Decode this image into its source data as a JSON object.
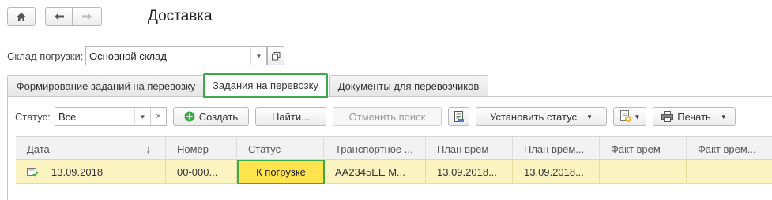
{
  "header": {
    "title": "Доставка"
  },
  "warehouse": {
    "label": "Склад погрузки:",
    "value": "Основной склад"
  },
  "tabs": [
    {
      "label": "Формирование заданий на перевозку",
      "active": false
    },
    {
      "label": "Задания на перевозку",
      "active": true
    },
    {
      "label": "Документы для перевозчиков",
      "active": false
    }
  ],
  "toolbar": {
    "status_label": "Статус:",
    "status_value": "Все",
    "create_label": "Создать",
    "find_label": "Найти...",
    "cancel_search_label": "Отменить поиск",
    "set_status_label": "Установить статус",
    "print_label": "Печать"
  },
  "table": {
    "columns": [
      "Дата",
      "Номер",
      "Статус",
      "Транспортное ...",
      "План врем",
      "План врем...",
      "Факт врем",
      "Факт врем..."
    ],
    "rows": [
      {
        "date": "13.09.2018",
        "number": "00-000...",
        "status": "К погрузке",
        "transport": "АА2345ЕЕ М...",
        "plan_time": "13.09.2018...",
        "plan_time2": "13.09.2018...",
        "fact_time": "",
        "fact_time2": ""
      }
    ]
  },
  "colors": {
    "highlight": "#3daa4a",
    "row_selected": "#fbf3c0",
    "status_badge": "#ffe44d"
  }
}
